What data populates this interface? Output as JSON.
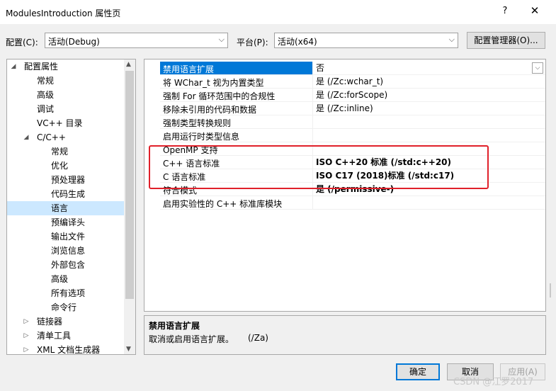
{
  "window": {
    "title": "ModulesIntroduction 属性页",
    "help": "?",
    "close": "✕"
  },
  "config_bar": {
    "config_label": "配置(C):",
    "config_value": "活动(Debug)",
    "platform_label": "平台(P):",
    "platform_value": "活动(x64)",
    "manager_button": "配置管理器(O)..."
  },
  "tree": {
    "items": [
      {
        "label": "配置属性",
        "toggle": "◢",
        "level": 0
      },
      {
        "label": "常规",
        "toggle": "",
        "level": 1
      },
      {
        "label": "高级",
        "toggle": "",
        "level": 1
      },
      {
        "label": "调试",
        "toggle": "",
        "level": 1
      },
      {
        "label": "VC++ 目录",
        "toggle": "",
        "level": 1
      },
      {
        "label": "C/C++",
        "toggle": "◢",
        "level": 1
      },
      {
        "label": "常规",
        "toggle": "",
        "level": 2
      },
      {
        "label": "优化",
        "toggle": "",
        "level": 2
      },
      {
        "label": "预处理器",
        "toggle": "",
        "level": 2
      },
      {
        "label": "代码生成",
        "toggle": "",
        "level": 2
      },
      {
        "label": "语言",
        "toggle": "",
        "level": 2,
        "selected": true
      },
      {
        "label": "预编译头",
        "toggle": "",
        "level": 2
      },
      {
        "label": "输出文件",
        "toggle": "",
        "level": 2
      },
      {
        "label": "浏览信息",
        "toggle": "",
        "level": 2
      },
      {
        "label": "外部包含",
        "toggle": "",
        "level": 2
      },
      {
        "label": "高级",
        "toggle": "",
        "level": 2
      },
      {
        "label": "所有选项",
        "toggle": "",
        "level": 2
      },
      {
        "label": "命令行",
        "toggle": "",
        "level": 2
      },
      {
        "label": "链接器",
        "toggle": "▷",
        "level": 1
      },
      {
        "label": "清单工具",
        "toggle": "▷",
        "level": 1
      },
      {
        "label": "XML 文档生成器",
        "toggle": "▷",
        "level": 1
      }
    ]
  },
  "grid": {
    "rows": [
      {
        "name": "禁用语言扩展",
        "value": "否",
        "selected": true,
        "bold": false
      },
      {
        "name": "将 WChar_t 视为内置类型",
        "value": "是 (/Zc:wchar_t)",
        "bold": false
      },
      {
        "name": "强制 For 循环范围中的合规性",
        "value": "是 (/Zc:forScope)",
        "bold": false
      },
      {
        "name": "移除未引用的代码和数据",
        "value": "是 (/Zc:inline)",
        "bold": false
      },
      {
        "name": "强制类型转换规则",
        "value": "",
        "bold": false
      },
      {
        "name": "启用运行时类型信息",
        "value": "",
        "bold": false
      },
      {
        "name": "OpenMP 支持",
        "value": "",
        "bold": false
      },
      {
        "name": "C++ 语言标准",
        "value": "ISO C++20 标准 (/std:c++20)",
        "bold": true
      },
      {
        "name": "C 语言标准",
        "value": "ISO C17 (2018)标准 (/std:c17)",
        "bold": true
      },
      {
        "name": "符合模式",
        "value": "是 (/permissive-)",
        "bold": true
      },
      {
        "name": "启用实验性的 C++ 标准库模块",
        "value": "",
        "bold": false
      }
    ]
  },
  "description": {
    "title": "禁用语言扩展",
    "text": "取消或启用语言扩展。",
    "flag": "(/Za)"
  },
  "buttons": {
    "ok": "确定",
    "cancel": "取消",
    "apply": "应用(A)"
  },
  "watermark": "CSDN @江罗2017",
  "colors": {
    "selection": "#0078d7",
    "annotation": "#e0202a",
    "tree_selection": "#cce8ff"
  }
}
